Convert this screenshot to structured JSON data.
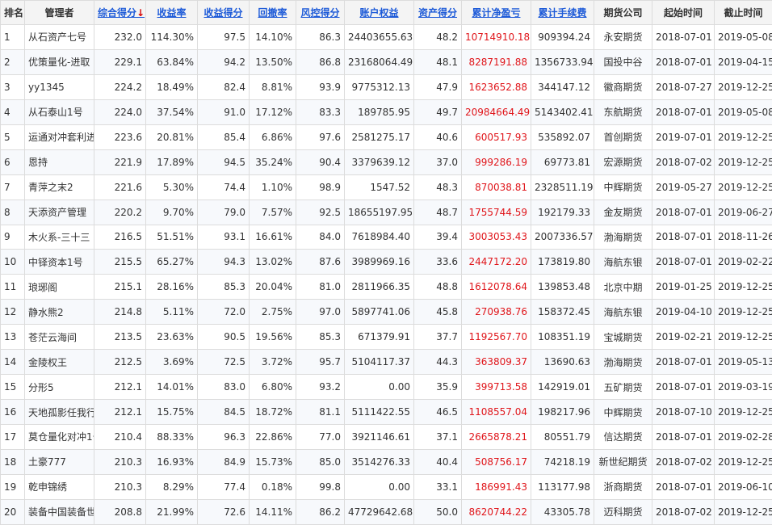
{
  "headers": [
    "排名",
    "管理者",
    "综合得分",
    "收益率",
    "收益得分",
    "回撤率",
    "风控得分",
    "账户权益",
    "资产得分",
    "累计净盈亏",
    "累计手续费",
    "期货公司",
    "起始时间",
    "截止时间"
  ],
  "sort_arrow": "↓",
  "colors": {
    "link_header": "#1e5bd8",
    "profit": "#e0161b",
    "sort_arrow": "#d60000"
  },
  "rows": [
    [
      "1",
      "从石资产七号",
      "232.0",
      "114.30%",
      "97.5",
      "14.10%",
      "86.3",
      "24403655.63",
      "48.2",
      "10714910.18",
      "909394.24",
      "永安期货",
      "2018-07-01",
      "2019-05-08"
    ],
    [
      "2",
      "优策量化-进取",
      "229.1",
      "63.84%",
      "94.2",
      "13.50%",
      "86.8",
      "23168064.49",
      "48.1",
      "8287191.88",
      "1356733.94",
      "国投中谷",
      "2018-07-01",
      "2019-04-15"
    ],
    [
      "3",
      "yy1345",
      "224.2",
      "18.49%",
      "82.4",
      "8.81%",
      "93.9",
      "9775312.13",
      "47.9",
      "1623652.88",
      "344147.12",
      "徽商期货",
      "2018-07-27",
      "2019-12-25"
    ],
    [
      "4",
      "从石泰山1号",
      "224.0",
      "37.54%",
      "91.0",
      "17.12%",
      "83.3",
      "189785.95",
      "49.7",
      "20984664.49",
      "5143402.41",
      "东航期货",
      "2018-07-01",
      "2019-05-08"
    ],
    [
      "5",
      "运通对冲套利进",
      "223.6",
      "20.81%",
      "85.4",
      "6.86%",
      "97.6",
      "2581275.17",
      "40.6",
      "600517.93",
      "535892.07",
      "首创期货",
      "2019-07-01",
      "2019-12-25"
    ],
    [
      "6",
      "恩持",
      "221.9",
      "17.89%",
      "94.5",
      "35.24%",
      "90.4",
      "3379639.12",
      "37.0",
      "999286.19",
      "69773.81",
      "宏源期货",
      "2018-07-02",
      "2019-12-25"
    ],
    [
      "7",
      "青萍之末2",
      "221.6",
      "5.30%",
      "74.4",
      "1.10%",
      "98.9",
      "1547.52",
      "48.3",
      "870038.81",
      "2328511.19",
      "中辉期货",
      "2019-05-27",
      "2019-12-25"
    ],
    [
      "8",
      "天添资产管理",
      "220.2",
      "9.70%",
      "79.0",
      "7.57%",
      "92.5",
      "18655197.95",
      "48.7",
      "1755744.59",
      "192179.33",
      "金友期货",
      "2018-07-01",
      "2019-06-27"
    ],
    [
      "9",
      "木火系-三十三",
      "216.5",
      "51.51%",
      "93.1",
      "16.61%",
      "84.0",
      "7618984.40",
      "39.4",
      "3003053.43",
      "2007336.57",
      "渤海期货",
      "2018-07-01",
      "2018-11-26"
    ],
    [
      "10",
      "中铎资本1号",
      "215.5",
      "65.27%",
      "94.3",
      "13.02%",
      "87.6",
      "3989969.16",
      "33.6",
      "2447172.20",
      "173819.80",
      "海航东银",
      "2018-07-01",
      "2019-02-22"
    ],
    [
      "11",
      "琅琊阁",
      "215.1",
      "28.16%",
      "85.3",
      "20.04%",
      "81.0",
      "2811966.35",
      "48.8",
      "1612078.64",
      "139853.48",
      "北京中期",
      "2019-01-25",
      "2019-12-25"
    ],
    [
      "12",
      "静水熊2",
      "214.8",
      "5.11%",
      "72.0",
      "2.75%",
      "97.0",
      "5897741.06",
      "45.8",
      "270938.76",
      "158372.45",
      "海航东银",
      "2019-04-10",
      "2019-12-25"
    ],
    [
      "13",
      "苍茫云海间",
      "213.5",
      "23.63%",
      "90.5",
      "19.56%",
      "85.3",
      "671379.91",
      "37.7",
      "1192567.70",
      "108351.19",
      "宝城期货",
      "2019-02-21",
      "2019-12-25"
    ],
    [
      "14",
      "金陵权王",
      "212.5",
      "3.69%",
      "72.5",
      "3.72%",
      "95.7",
      "5104117.37",
      "44.3",
      "363809.37",
      "13690.63",
      "渤海期货",
      "2018-07-01",
      "2019-05-13"
    ],
    [
      "15",
      "分形5",
      "212.1",
      "14.01%",
      "83.0",
      "6.80%",
      "93.2",
      "0.00",
      "35.9",
      "399713.58",
      "142919.01",
      "五矿期货",
      "2018-07-01",
      "2019-03-19"
    ],
    [
      "16",
      "天地孤影任我行",
      "212.1",
      "15.75%",
      "84.5",
      "18.72%",
      "81.1",
      "5111422.55",
      "46.5",
      "1108557.04",
      "198217.96",
      "中辉期货",
      "2018-07-10",
      "2019-12-25"
    ],
    [
      "17",
      "莫仓量化对冲1号",
      "210.4",
      "88.33%",
      "96.3",
      "22.86%",
      "77.0",
      "3921146.61",
      "37.1",
      "2665878.21",
      "80551.79",
      "信达期货",
      "2018-07-01",
      "2019-02-28"
    ],
    [
      "18",
      "土豪777",
      "210.3",
      "16.93%",
      "84.9",
      "15.73%",
      "85.0",
      "3514276.33",
      "40.4",
      "508756.17",
      "74218.19",
      "新世纪期货",
      "2018-07-02",
      "2019-12-25"
    ],
    [
      "19",
      "乾申锦绣",
      "210.3",
      "8.29%",
      "77.4",
      "0.18%",
      "99.8",
      "0.00",
      "33.1",
      "186991.43",
      "113177.98",
      "浙商期货",
      "2018-07-01",
      "2019-06-10"
    ],
    [
      "20",
      "装备中国装备世",
      "208.8",
      "21.99%",
      "72.6",
      "14.11%",
      "86.2",
      "47729642.68",
      "50.0",
      "8620744.22",
      "43305.78",
      "迈科期货",
      "2018-07-02",
      "2019-12-25"
    ]
  ]
}
